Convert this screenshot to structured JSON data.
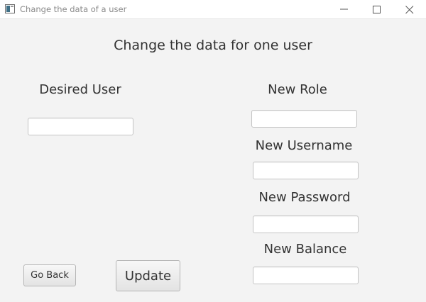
{
  "window": {
    "title": "Change the data of a user"
  },
  "form": {
    "heading": "Change the data for one user",
    "desired_user": {
      "label": "Desired User",
      "value": "",
      "placeholder": ""
    },
    "new_role": {
      "label": "New Role",
      "value": "",
      "placeholder": ""
    },
    "new_username": {
      "label": "New Username",
      "value": "",
      "placeholder": ""
    },
    "new_password": {
      "label": "New Password",
      "value": "",
      "placeholder": ""
    },
    "new_balance": {
      "label": "New Balance",
      "value": "",
      "placeholder": ""
    }
  },
  "buttons": {
    "go_back": "Go Back",
    "update": "Update"
  },
  "icons": {
    "app": "app-window-icon",
    "minimize": "minimize-icon",
    "maximize": "maximize-icon",
    "close": "close-icon"
  },
  "colors": {
    "background": "#f3f3f3",
    "titlebar": "#ffffff",
    "text": "#333333"
  }
}
